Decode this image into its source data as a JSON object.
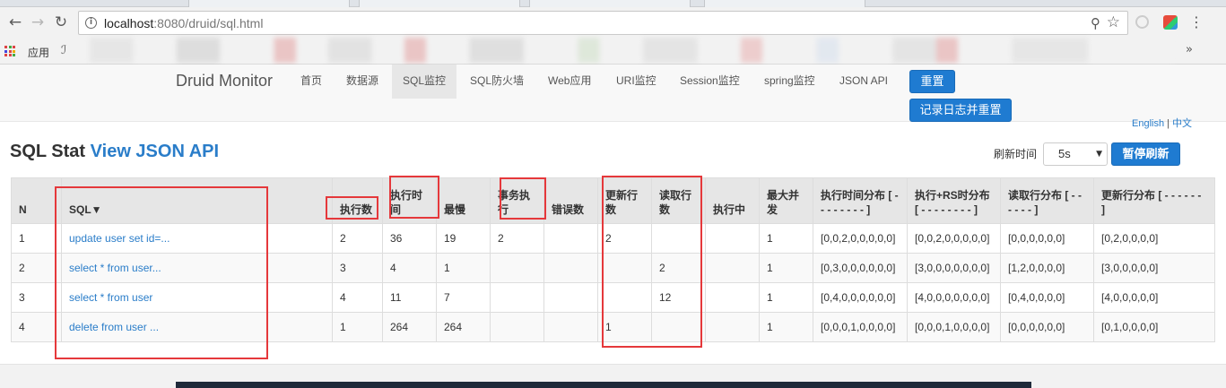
{
  "browser": {
    "url_host": "localhost",
    "url_rest": ":8080/druid/sql.html",
    "bookmarks_apps_label": "应用"
  },
  "navbar": {
    "brand": "Druid Monitor",
    "links": [
      "首页",
      "数据源",
      "SQL监控",
      "SQL防火墙",
      "Web应用",
      "URI监控",
      "Session监控",
      "spring监控",
      "JSON API"
    ],
    "active_index": 2,
    "reset_button": "重置",
    "log_reset_button": "记录日志并重置"
  },
  "lang": {
    "english": "English",
    "sep": "|",
    "chinese": "中文"
  },
  "header": {
    "title_prefix": "SQL Stat ",
    "title_link": "View JSON API",
    "refresh_label": "刷新时间",
    "refresh_value": "5s",
    "pause_button": "暂停刷新"
  },
  "table": {
    "columns": [
      "N",
      "SQL▼",
      "执行数",
      "执行时间",
      "最慢",
      "事务执行",
      "错误数",
      "更新行数",
      "读取行数",
      "执行中",
      "最大并发",
      "执行时间分布 [ - - - - - - - - ]",
      "执行+RS时分布 [ - - - - - - - - ]",
      "读取行分布 [ - - - - - - ]",
      "更新行分布 [ - - - - - - ]"
    ],
    "rows": [
      [
        "1",
        "update user set id=...",
        "2",
        "36",
        "19",
        "2",
        "",
        "2",
        "",
        "",
        "1",
        "[0,0,2,0,0,0,0,0]",
        "[0,0,2,0,0,0,0,0]",
        "[0,0,0,0,0,0]",
        "[0,2,0,0,0,0]"
      ],
      [
        "2",
        "select * from user...",
        "3",
        "4",
        "1",
        "",
        "",
        "",
        "2",
        "",
        "1",
        "[0,3,0,0,0,0,0,0]",
        "[3,0,0,0,0,0,0,0]",
        "[1,2,0,0,0,0]",
        "[3,0,0,0,0,0]"
      ],
      [
        "3",
        "select * from user",
        "4",
        "11",
        "7",
        "",
        "",
        "",
        "12",
        "",
        "1",
        "[0,4,0,0,0,0,0,0]",
        "[4,0,0,0,0,0,0,0]",
        "[0,4,0,0,0,0]",
        "[4,0,0,0,0,0]"
      ],
      [
        "4",
        "delete from user ...",
        "1",
        "264",
        "264",
        "",
        "",
        "1",
        "",
        "",
        "1",
        "[0,0,0,1,0,0,0,0]",
        "[0,0,0,1,0,0,0,0]",
        "[0,0,0,0,0,0]",
        "[0,1,0,0,0,0]"
      ]
    ]
  },
  "colors": {
    "primary_button": "#1f7bd1",
    "link": "#2a7dc9",
    "annotation_box": "#e5383b",
    "header_bg": "#e6e6e6"
  }
}
